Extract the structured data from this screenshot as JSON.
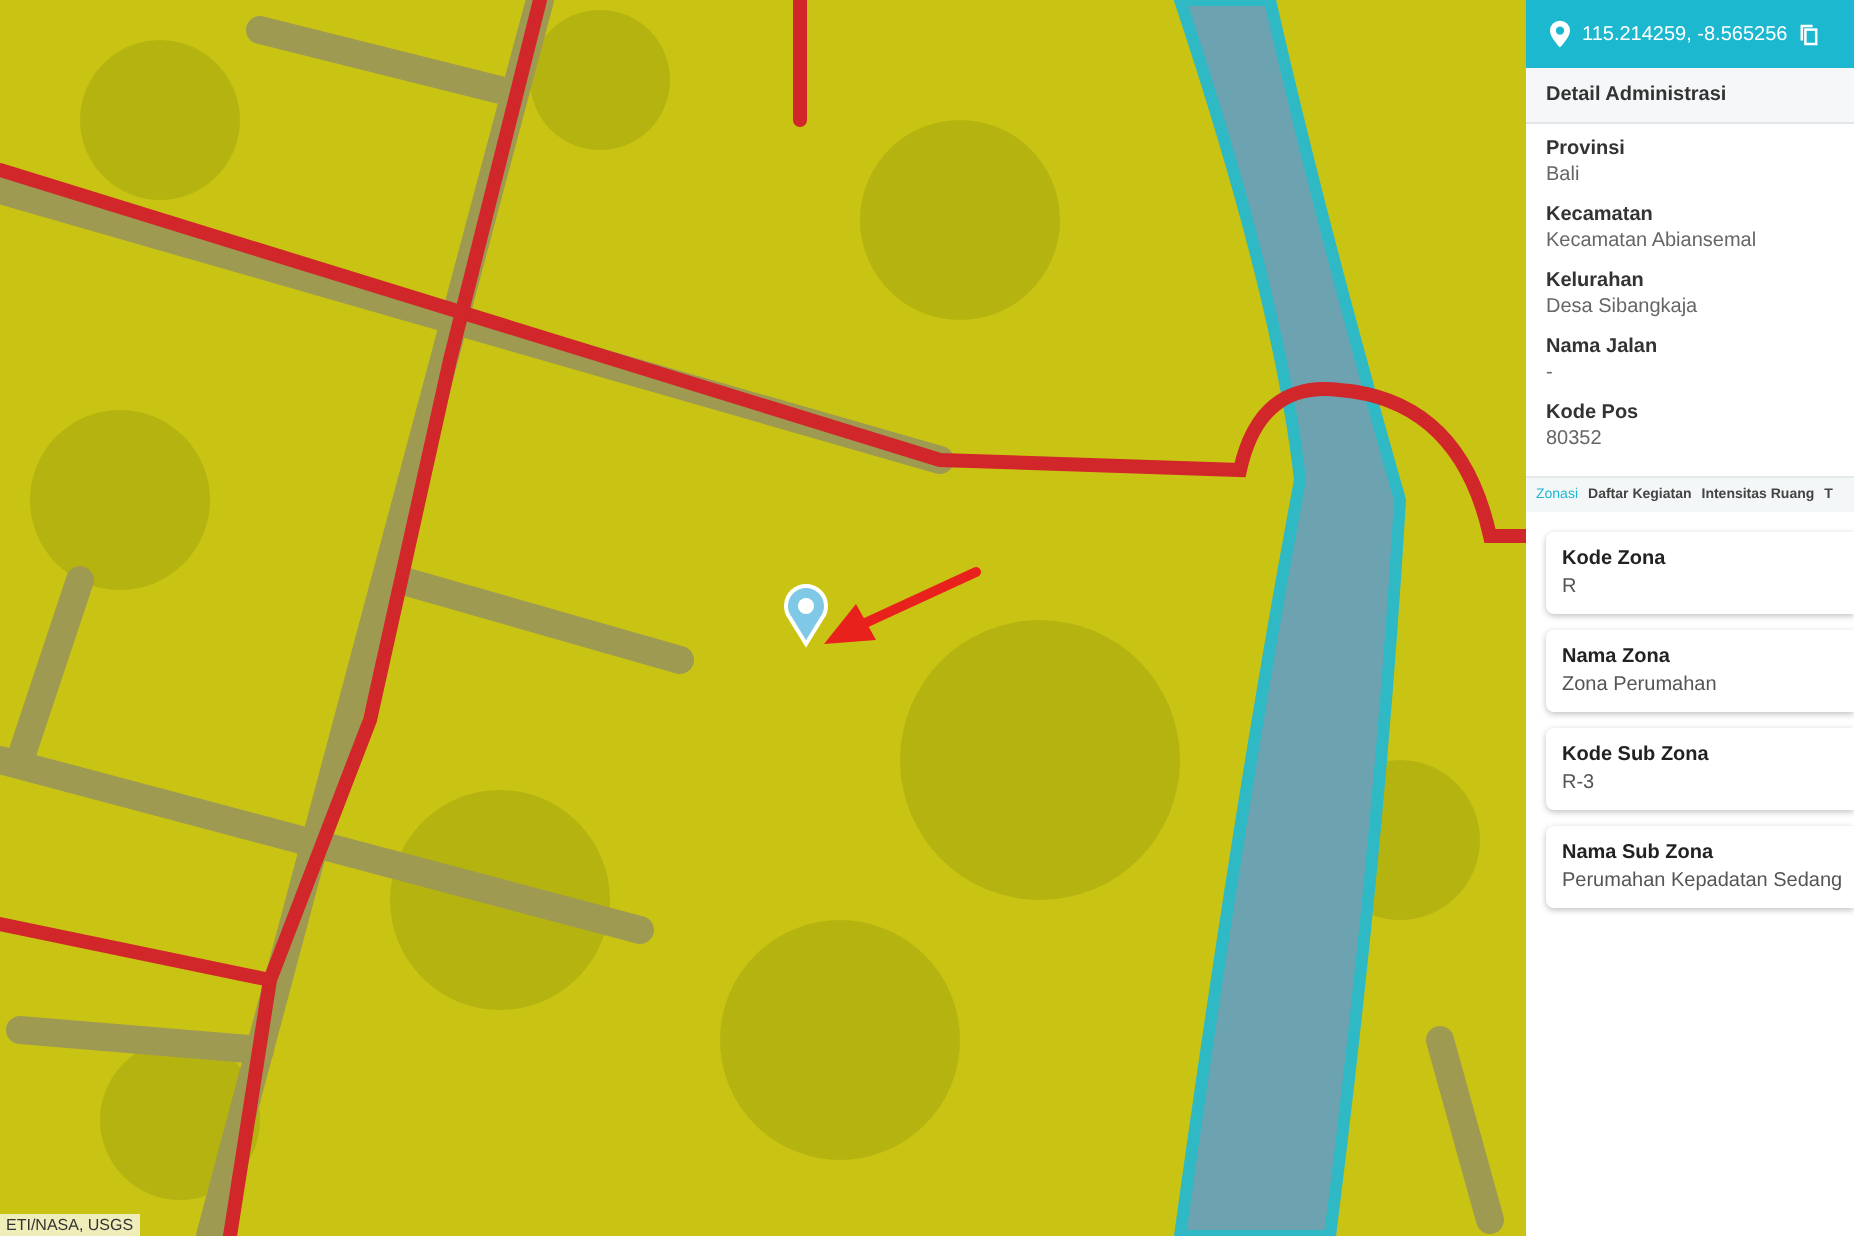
{
  "map": {
    "attribution": "ETI/NASA, USGS"
  },
  "panel": {
    "coordinates": "115.214259, -8.565256",
    "section_title": "Detail Administrasi",
    "details": [
      {
        "label": "Provinsi",
        "value": "Bali"
      },
      {
        "label": "Kecamatan",
        "value": "Kecamatan Abiansemal"
      },
      {
        "label": "Kelurahan",
        "value": "Desa Sibangkaja"
      },
      {
        "label": "Nama Jalan",
        "value": "-"
      },
      {
        "label": "Kode Pos",
        "value": "80352"
      }
    ],
    "tabs": [
      {
        "label": "Zonasi",
        "selected": true
      },
      {
        "label": "Daftar Kegiatan",
        "selected": false
      },
      {
        "label": "Intensitas Ruang",
        "selected": false
      },
      {
        "label": "T",
        "selected": false
      }
    ],
    "zone_cards": [
      {
        "label": "Kode Zona",
        "value": "R"
      },
      {
        "label": "Nama Zona",
        "value": "Zona Perumahan"
      },
      {
        "label": "Kode Sub Zona",
        "value": "R-3"
      },
      {
        "label": "Nama Sub Zona",
        "value": "Perumahan Kepadatan Sedang"
      }
    ]
  }
}
